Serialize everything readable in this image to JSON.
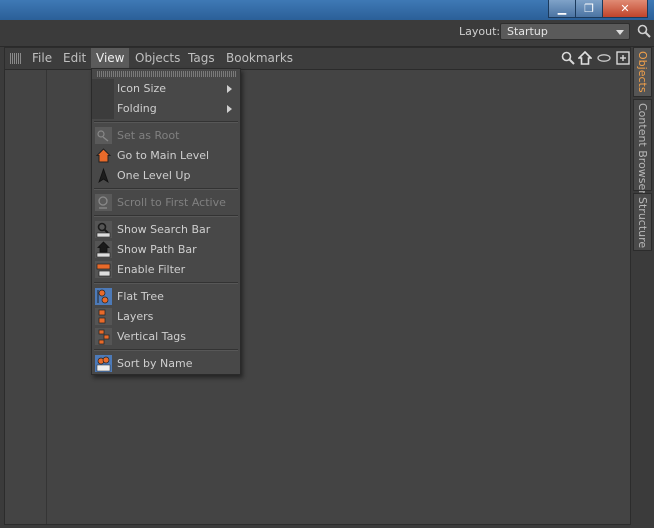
{
  "window": {
    "minimize_glyph": "▁",
    "maximize_glyph": "❐",
    "close_glyph": "✕"
  },
  "layout_bar": {
    "label": "Layout:",
    "selected": "Startup"
  },
  "menubar": {
    "items": [
      "File",
      "Edit",
      "View",
      "Objects",
      "Tags",
      "Bookmarks"
    ],
    "active": "View"
  },
  "side_tabs": [
    "Objects",
    "Content Browser",
    "Structure"
  ],
  "view_menu": {
    "items": [
      {
        "label": "Icon Size",
        "submenu": true,
        "enabled": true,
        "icon": "none"
      },
      {
        "label": "Folding",
        "submenu": true,
        "enabled": true,
        "icon": "none"
      },
      {
        "label": "Set as Root",
        "submenu": false,
        "enabled": false,
        "icon": "set-root-icon"
      },
      {
        "label": "Go to Main Level",
        "submenu": false,
        "enabled": true,
        "icon": "home-icon"
      },
      {
        "label": "One Level Up",
        "submenu": false,
        "enabled": true,
        "icon": "arrow-up-icon"
      },
      {
        "label": "Scroll to First Active",
        "submenu": false,
        "enabled": false,
        "icon": "scroll-icon"
      },
      {
        "label": "Show Search Bar",
        "submenu": false,
        "enabled": true,
        "icon": "search-bar-icon"
      },
      {
        "label": "Show Path Bar",
        "submenu": false,
        "enabled": true,
        "icon": "path-bar-icon"
      },
      {
        "label": "Enable Filter",
        "submenu": false,
        "enabled": true,
        "icon": "filter-icon"
      },
      {
        "label": "Flat Tree",
        "submenu": false,
        "enabled": true,
        "icon": "flat-tree-icon"
      },
      {
        "label": "Layers",
        "submenu": false,
        "enabled": true,
        "icon": "layers-icon"
      },
      {
        "label": "Vertical Tags",
        "submenu": false,
        "enabled": true,
        "icon": "vertical-tags-icon"
      },
      {
        "label": "Sort by Name",
        "submenu": false,
        "enabled": true,
        "icon": "sort-by-name-icon"
      }
    ]
  },
  "colors": {
    "accent": "#f2a14a",
    "icon_orange": "#e86a2a",
    "background": "#444444"
  }
}
